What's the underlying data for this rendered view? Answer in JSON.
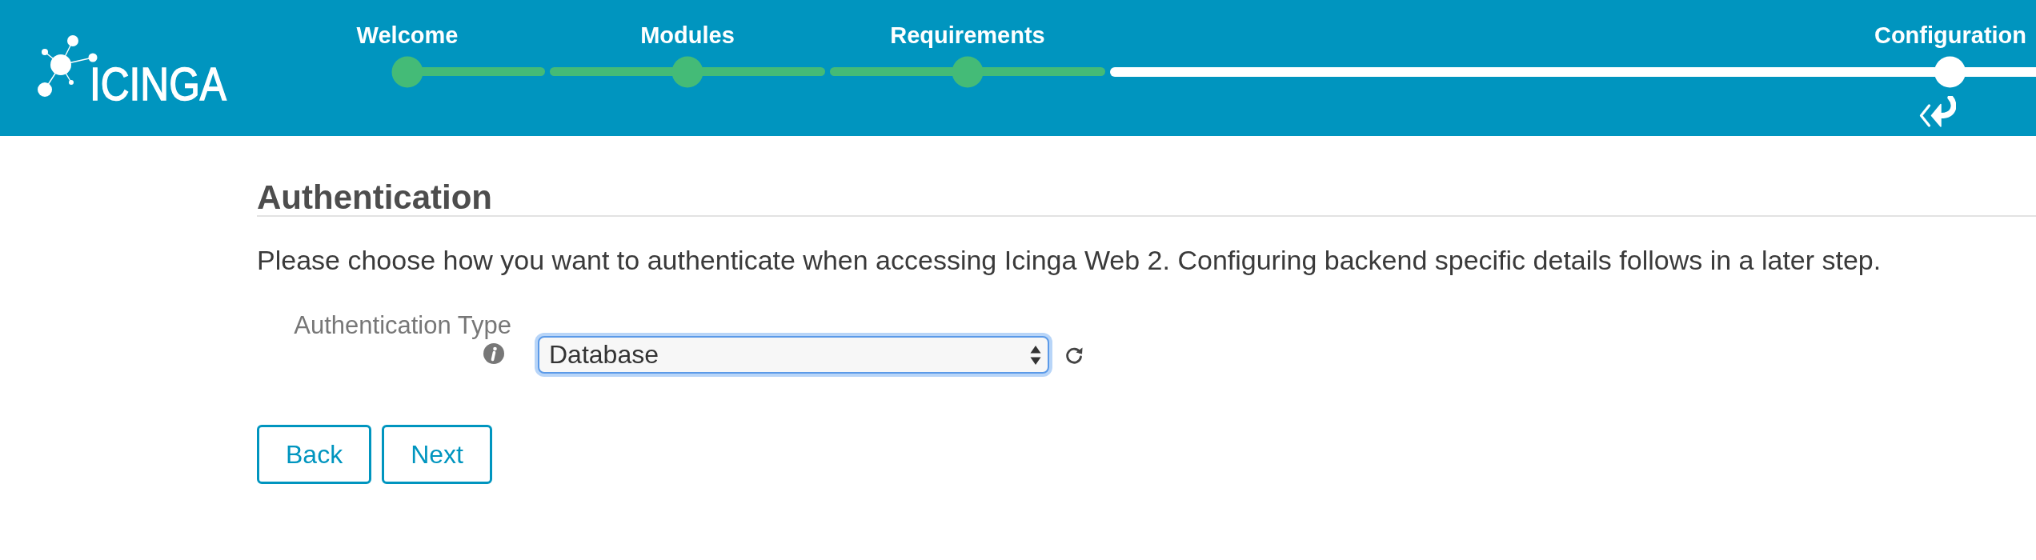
{
  "logo": {
    "text": "ICINGA"
  },
  "steps": [
    {
      "label": "Welcome",
      "selected": false
    },
    {
      "label": "Modules",
      "selected": false
    },
    {
      "label": "Requirements",
      "selected": false
    },
    {
      "label": "Configuration",
      "selected": true
    }
  ],
  "section": {
    "title": "Authentication",
    "description": "Please choose how you want to authenticate when accessing Icinga Web 2. Configuring backend specific details follows in a later step."
  },
  "form": {
    "fields": [
      {
        "label": "Authentication Type",
        "kind": "select",
        "value": "Database",
        "focused": true
      }
    ]
  },
  "buttons": [
    {
      "label": "Back"
    },
    {
      "label": "Next"
    }
  ]
}
